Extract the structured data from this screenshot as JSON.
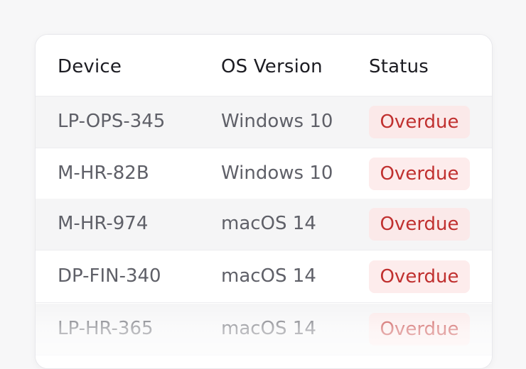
{
  "table": {
    "headers": {
      "device": "Device",
      "os_version": "OS Version",
      "status": "Status"
    },
    "rows": [
      {
        "device": "LP-OPS-345",
        "os_version": "Windows 10",
        "status": "Overdue"
      },
      {
        "device": "M-HR-82B",
        "os_version": "Windows 10",
        "status": "Overdue"
      },
      {
        "device": "M-HR-974",
        "os_version": "macOS 14",
        "status": "Overdue"
      },
      {
        "device": "DP-FIN-340",
        "os_version": "macOS 14",
        "status": "Overdue"
      },
      {
        "device": "LP-HR-365",
        "os_version": "macOS 14",
        "status": "Overdue"
      }
    ]
  },
  "colors": {
    "status_overdue_text": "#c0302f",
    "status_overdue_bg": "#fdecec"
  }
}
